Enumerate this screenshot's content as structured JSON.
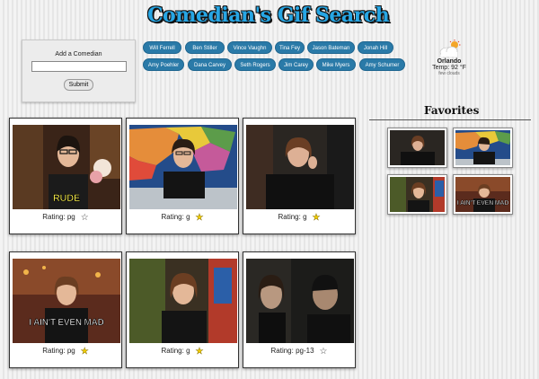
{
  "header": {
    "title": "Comedian's Gif Search"
  },
  "add_panel": {
    "label": "Add a Comedian",
    "input_value": "",
    "submit_label": "Submit"
  },
  "comedian_buttons": [
    "Will Ferrell",
    "Ben Stiller",
    "Vince Vaughn",
    "Tina Fey",
    "Jason Bateman",
    "Jonah Hill",
    "Amy Poehler",
    "Dana Carvey",
    "Seth Rogers",
    "Jim Carey",
    "Mike Myers",
    "Amy Schumer"
  ],
  "weather": {
    "city": "Orlando",
    "temp": "Temp: 92 °F",
    "conditions": "few clouds",
    "icon": "cloud-sun-icon"
  },
  "results": [
    {
      "rating": "Rating: pg",
      "caption": "RUDE",
      "starred": false
    },
    {
      "rating": "Rating: g",
      "caption": "",
      "starred": true
    },
    {
      "rating": "Rating: g",
      "caption": "",
      "starred": true
    },
    {
      "rating": "Rating: pg",
      "caption": "I AIN'T EVEN MAD",
      "starred": true
    },
    {
      "rating": "Rating: g",
      "caption": "",
      "starred": true
    },
    {
      "rating": "Rating: pg-13",
      "caption": "",
      "starred": false
    }
  ],
  "favorites": {
    "title": "Favorites",
    "items": [
      {
        "caption": ""
      },
      {
        "caption": ""
      },
      {
        "caption": ""
      },
      {
        "caption": "I AIN'T EVEN MAD"
      }
    ]
  },
  "colors": {
    "title": "#27a6e4",
    "button": "#2a7aa8",
    "star_filled": "#f2cd00"
  }
}
